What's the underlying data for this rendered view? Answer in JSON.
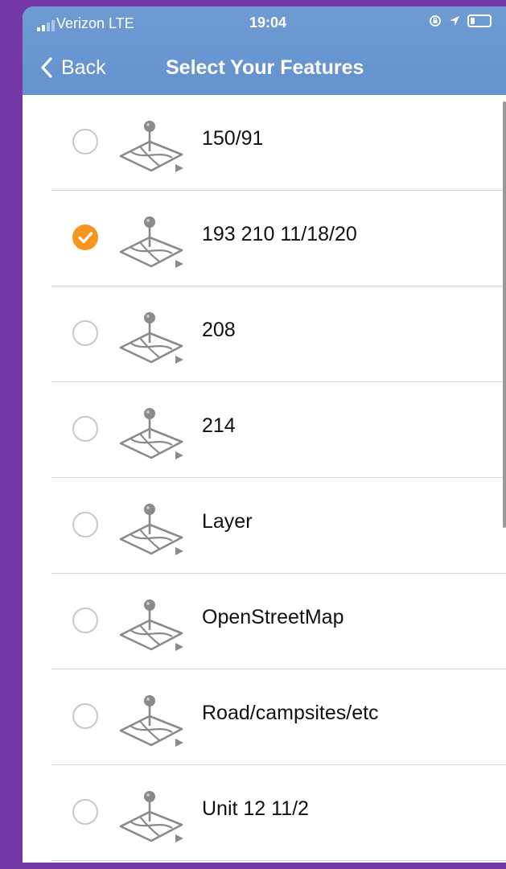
{
  "status_bar": {
    "carrier": "Verizon  LTE",
    "time": "19:04"
  },
  "nav": {
    "back_label": "Back",
    "title": "Select Your Features"
  },
  "colors": {
    "header": "#6b97d0",
    "frame": "#7338a6",
    "check": "#f5961e"
  },
  "features": [
    {
      "label": "150/91",
      "selected": false
    },
    {
      "label": "193 210 11/18/20",
      "selected": true
    },
    {
      "label": "208",
      "selected": false
    },
    {
      "label": "214",
      "selected": false
    },
    {
      "label": "Layer",
      "selected": false
    },
    {
      "label": "OpenStreetMap",
      "selected": false
    },
    {
      "label": "Road/campsites/etc",
      "selected": false
    },
    {
      "label": "Unit 12 11/2",
      "selected": false
    }
  ]
}
